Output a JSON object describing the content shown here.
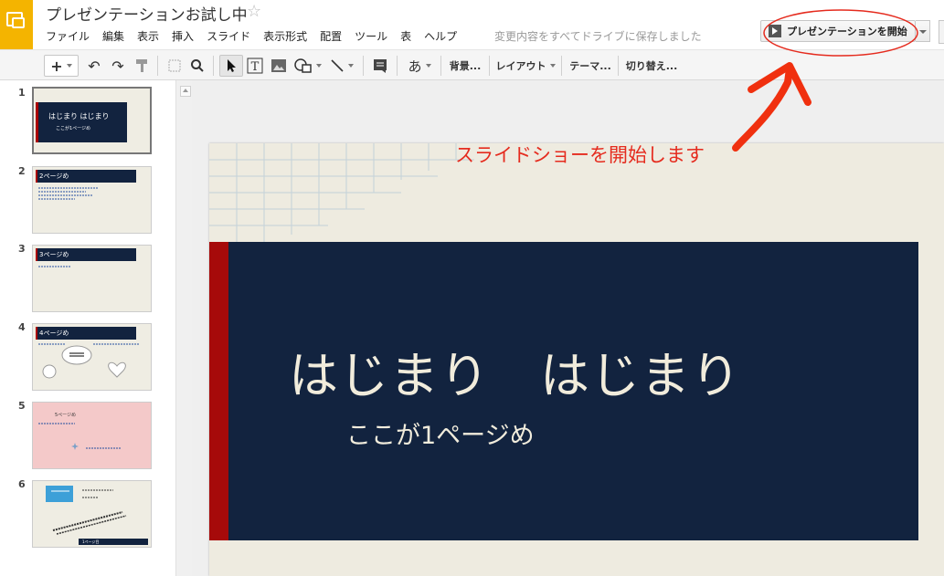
{
  "header": {
    "doc_title": "プレゼンテーションお試し中",
    "star_icon": "star-outline-icon",
    "save_status": "変更内容をすべてドライブに保存しました",
    "present_label": "プレゼンテーションを開始"
  },
  "menu": [
    "ファイル",
    "編集",
    "表示",
    "挿入",
    "スライド",
    "表示形式",
    "配置",
    "ツール",
    "表",
    "ヘルプ"
  ],
  "toolbar": {
    "text_style_label": "あ",
    "background_label": "背景...",
    "layout_label": "レイアウト",
    "theme_label": "テーマ...",
    "transition_label": "切り替え..."
  },
  "filmstrip": [
    {
      "number": "1",
      "title": "はじまり はじまり",
      "subtitle": "ここが1ページめ"
    },
    {
      "number": "2",
      "title": "2ページめ"
    },
    {
      "number": "3",
      "title": "3ページめ"
    },
    {
      "number": "4",
      "title": "4ページめ"
    },
    {
      "number": "5",
      "title": "5ページめ"
    },
    {
      "number": "6",
      "title": "1ページ目"
    }
  ],
  "slide": {
    "title": "はじまり　はじまり",
    "subtitle": "ここが1ページめ"
  },
  "annotation": {
    "text": "スライドショーを開始します",
    "color": "#e52b1e"
  },
  "colors": {
    "accent": "#f4b400",
    "slide_title_bg": "#12233f",
    "slide_red": "#a60a0a",
    "slide_bg": "#eeebe0"
  }
}
